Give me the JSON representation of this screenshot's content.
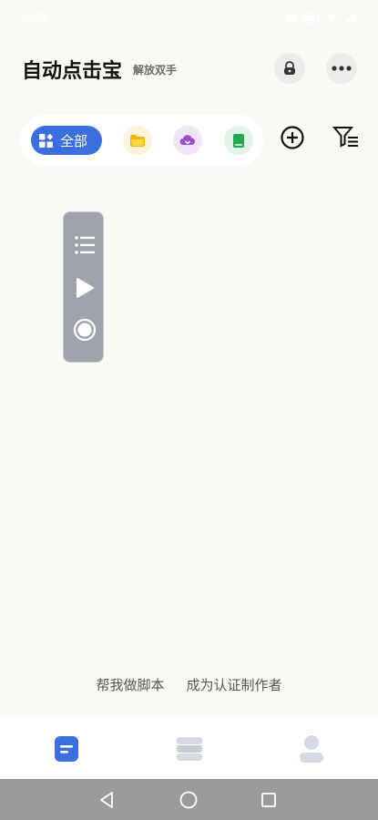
{
  "status_bar": {
    "time": "5:29",
    "icons": [
      "notification-icon",
      "battery-icon",
      "wifi-icon",
      "signal-icon"
    ]
  },
  "header": {
    "title": "自动点击宝",
    "subtitle": "解放双手"
  },
  "filter": {
    "all_label": "全部",
    "categories": [
      {
        "name": "folder",
        "color": "#f5b800"
      },
      {
        "name": "cloud",
        "color": "#9a4fd0"
      },
      {
        "name": "book",
        "color": "#22a853"
      }
    ]
  },
  "floating_panel": {
    "icons": [
      "list-icon",
      "play-icon",
      "record-icon"
    ]
  },
  "links": {
    "help_script": "帮我做脚本",
    "become_author": "成为认证制作者"
  },
  "bottom_nav": {
    "items": [
      "home",
      "library",
      "profile"
    ],
    "active": "home"
  },
  "colors": {
    "accent": "#3b6fe0",
    "background": "#fafaf5",
    "panel": "#9fa3ad",
    "nav_inactive": "#d6d9e4"
  }
}
